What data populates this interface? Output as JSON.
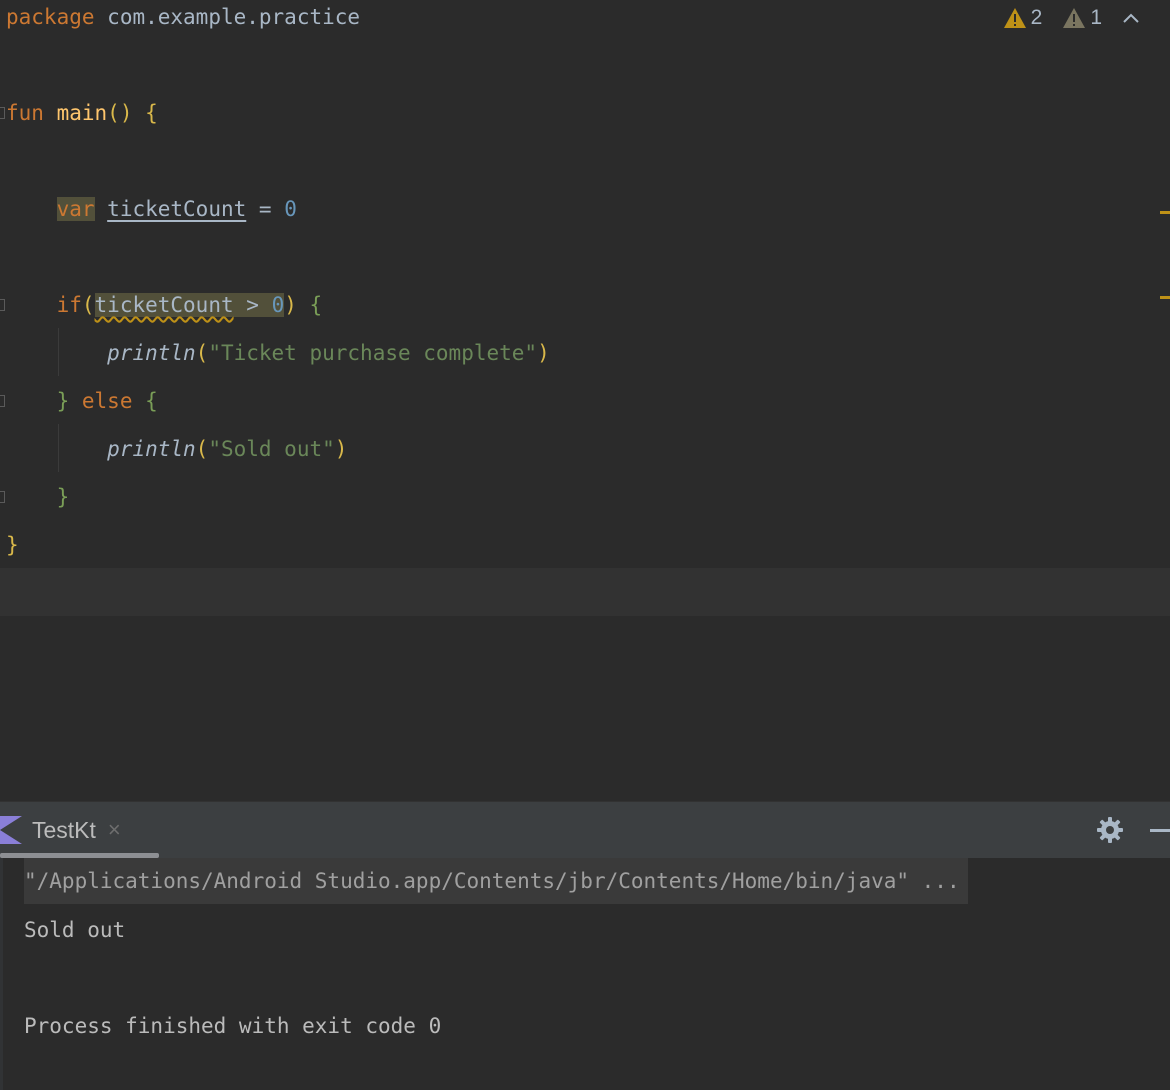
{
  "editor": {
    "package_kw": "package",
    "package_name": "com.example.practice",
    "fun_kw": "fun",
    "fun_name": "main",
    "fun_parens": "()",
    "open_brace": "{",
    "var_kw": "var",
    "var_name": "ticketCount",
    "assign": "=",
    "zero": "0",
    "if_kw": "if",
    "if_open": "(",
    "if_var": "ticketCount",
    "if_op": ">",
    "if_zero": "0",
    "if_close": ")",
    "if_brace": "{",
    "println": "println",
    "paren_open": "(",
    "paren_close": ")",
    "str_complete": "\"Ticket purchase complete\"",
    "close_brace": "}",
    "else_kw": "else",
    "else_brace": "{",
    "str_soldout": "\"Sold out\"",
    "inner_close": "}",
    "outer_close": "}"
  },
  "inspection": {
    "warnings_count": "2",
    "weak_warnings_count": "1",
    "warning_color": "#be9117"
  },
  "run_panel": {
    "tab_label": "TestKt",
    "tab_close": "×",
    "command": "\"/Applications/Android Studio.app/Contents/jbr/Contents/Home/bin/java\" ...",
    "output": "Sold out",
    "exit_message": "Process finished with exit code 0"
  },
  "icons": [
    "warning-icon",
    "weak-warning-icon",
    "chevron-up-icon",
    "kotlin-icon",
    "close-icon",
    "gear-icon",
    "minimize-icon"
  ]
}
